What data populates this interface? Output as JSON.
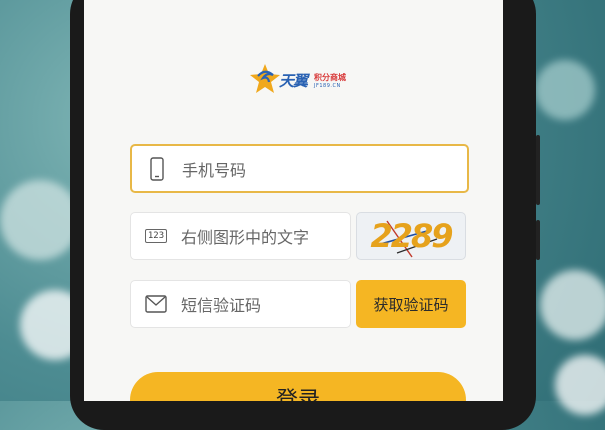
{
  "brand": {
    "title": "天翼",
    "subtitle": "积分商城",
    "domain": "JF189.CN"
  },
  "form": {
    "phone_placeholder": "手机号码",
    "captcha_placeholder": "右侧图形中的文字",
    "captcha_code": "2289",
    "captcha_icon_text": "123",
    "sms_placeholder": "短信验证码",
    "sms_button_label": "获取验证码",
    "login_button_label": "登录"
  },
  "colors": {
    "accent": "#f5b623",
    "active_border": "#e8b847",
    "brand_blue": "#2a62b3"
  }
}
